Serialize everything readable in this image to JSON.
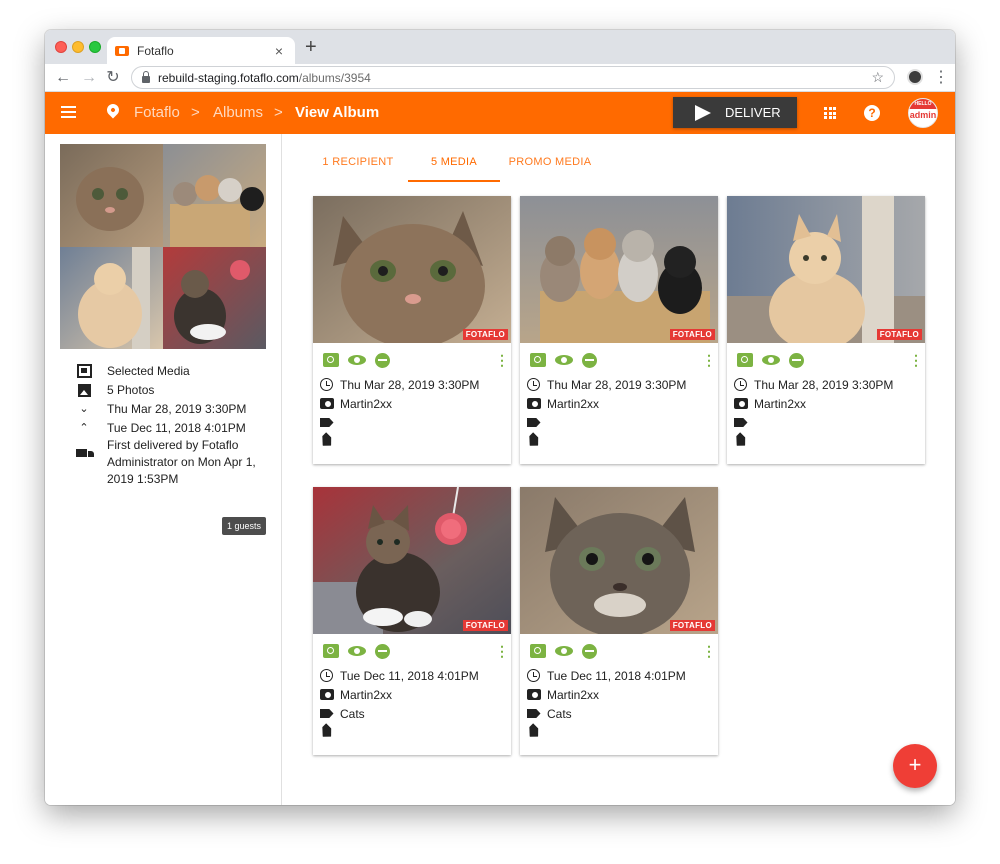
{
  "browser": {
    "tab_title": "Fotaflo",
    "new_tab": "+",
    "close_tab": "×",
    "url_host": "rebuild-staging.fotaflo.com",
    "url_path": "/albums/3954",
    "back": "←",
    "forward": "→",
    "reload": "↻",
    "bookmark": "☆",
    "menu": "⋮"
  },
  "appbar": {
    "breadcrumbs": [
      "Fotaflo",
      "Albums",
      "View Album"
    ],
    "separator": ">",
    "deliver_label": "DELIVER",
    "help": "?",
    "avatar_top": "HELLO",
    "avatar_name": "admin",
    "color": "#ff6a00"
  },
  "sidebar": {
    "selected_media": "Selected Media",
    "photo_count": "5 Photos",
    "date_down": "Thu Mar 28, 2019 3:30PM",
    "date_up": "Tue Dec 11, 2018 4:01PM",
    "delivered_line1": "First delivered by Fotaflo",
    "delivered_line2": "Administrator on Mon Apr 1,",
    "delivered_line3": "2019 1:53PM",
    "guests_badge": "1 guests"
  },
  "tabs": [
    {
      "label": "1 RECIPIENT"
    },
    {
      "label": "5 MEDIA",
      "active": true
    },
    {
      "label": "PROMO MEDIA"
    }
  ],
  "media": [
    {
      "date": "Thu Mar 28, 2019 3:30PM",
      "photographer": "Martin2xx",
      "label": "",
      "badge": "FOTAFLO"
    },
    {
      "date": "Thu Mar 28, 2019 3:30PM",
      "photographer": "Martin2xx",
      "label": "",
      "badge": "FOTAFLO"
    },
    {
      "date": "Thu Mar 28, 2019 3:30PM",
      "photographer": "Martin2xx",
      "label": "",
      "badge": "FOTAFLO"
    },
    {
      "date": "Tue Dec 11, 2018 4:01PM",
      "photographer": "Martin2xx",
      "label": "Cats",
      "badge": "FOTAFLO"
    },
    {
      "date": "Tue Dec 11, 2018 4:01PM",
      "photographer": "Martin2xx",
      "label": "Cats",
      "badge": "FOTAFLO"
    }
  ],
  "card_more": "⋮",
  "fab_label": "+"
}
